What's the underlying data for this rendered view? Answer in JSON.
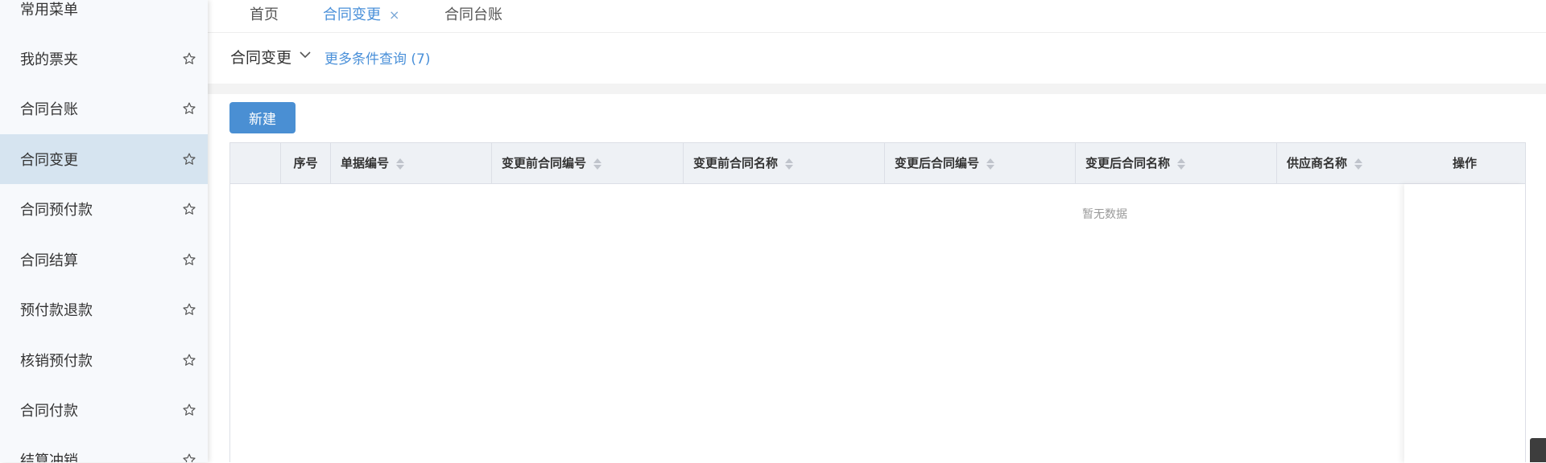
{
  "sidebar": {
    "items": [
      {
        "label": "常用菜单",
        "star": false,
        "active": false
      },
      {
        "label": "我的票夹",
        "star": true,
        "active": false
      },
      {
        "label": "合同台账",
        "star": true,
        "active": false
      },
      {
        "label": "合同变更",
        "star": true,
        "active": true
      },
      {
        "label": "合同预付款",
        "star": true,
        "active": false
      },
      {
        "label": "合同结算",
        "star": true,
        "active": false
      },
      {
        "label": "预付款退款",
        "star": true,
        "active": false
      },
      {
        "label": "核销预付款",
        "star": true,
        "active": false
      },
      {
        "label": "合同付款",
        "star": true,
        "active": false
      },
      {
        "label": "结算冲销",
        "star": true,
        "active": false
      }
    ],
    "star_icon": "star-outline-icon"
  },
  "tabs": [
    {
      "label": "首页",
      "active": false,
      "closable": false
    },
    {
      "label": "合同变更",
      "active": true,
      "closable": true,
      "close_glyph": "×"
    },
    {
      "label": "合同台账",
      "active": false,
      "closable": false
    }
  ],
  "query": {
    "title": "合同变更",
    "more_label": "更多条件查询 (7)"
  },
  "toolbar": {
    "new_label": "新建"
  },
  "table": {
    "columns": [
      {
        "label": "",
        "sortable": false
      },
      {
        "label": "序号",
        "sortable": false
      },
      {
        "label": "单据编号",
        "sortable": true
      },
      {
        "label": "变更前合同编号",
        "sortable": true
      },
      {
        "label": "变更前合同名称",
        "sortable": true
      },
      {
        "label": "变更后合同编号",
        "sortable": true
      },
      {
        "label": "变更后合同名称",
        "sortable": true
      },
      {
        "label": "供应商名称",
        "sortable": true
      },
      {
        "label": "操作",
        "sortable": false
      }
    ],
    "rows": [],
    "empty_text": "暂无数据"
  },
  "colors": {
    "accent": "#4a90d9",
    "button": "#4a8fd3",
    "active_sidebar": "#d6e4f0",
    "header_bg": "#eef1f5"
  }
}
